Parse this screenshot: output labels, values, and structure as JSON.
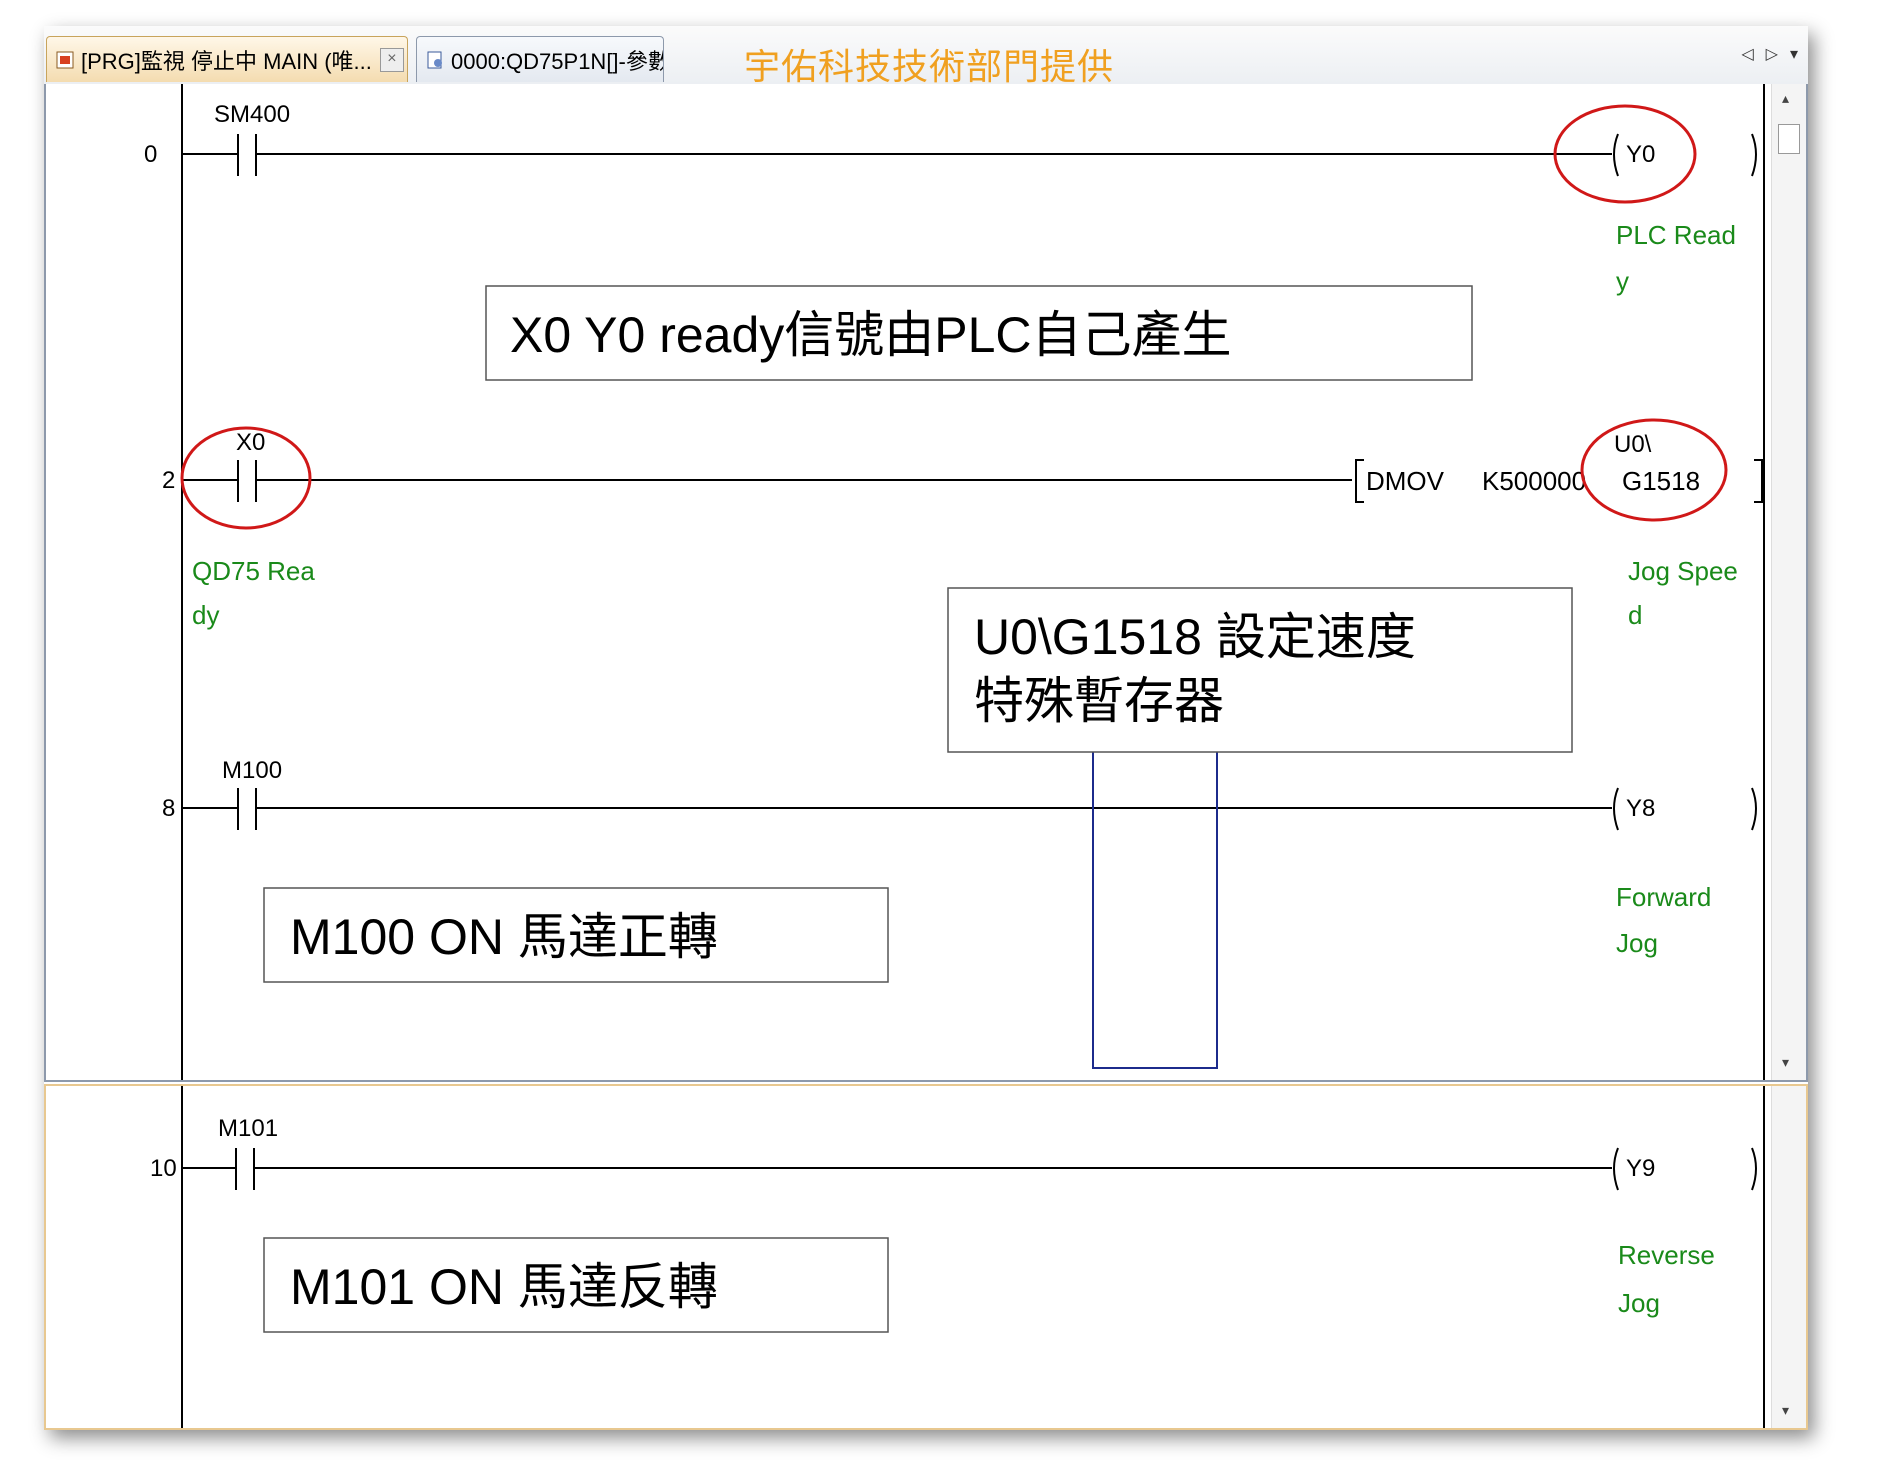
{
  "tabs": [
    {
      "label": "[PRG]監視 停止中 MAIN (唯...",
      "close": "×",
      "icon": "program-icon"
    },
    {
      "label": "0000:QD75P1N[]-參數",
      "icon": "parameter-icon"
    }
  ],
  "banner": "宇佑科技技術部門提供",
  "nav": {
    "left": "◁",
    "right": "▷",
    "dropdown": "▾"
  },
  "scroll": {
    "up": "▴",
    "down": "▾"
  },
  "rungs": [
    {
      "step": "0",
      "contact": "SM400",
      "coil": "Y0",
      "comment": [
        "PLC Read",
        "y"
      ]
    },
    {
      "step": "2",
      "contact": "X0",
      "contact_comment": [
        "QD75 Rea",
        "dy"
      ],
      "instr": "DMOV",
      "src": "K500000",
      "dst_top": "U0\\",
      "dst": "G1518",
      "comment": [
        "Jog Spee",
        "d"
      ]
    },
    {
      "step": "8",
      "contact": "M100",
      "coil": "Y8",
      "comment": [
        "Forward",
        "Jog"
      ]
    },
    {
      "step": "10",
      "contact": "M101",
      "coil": "Y9",
      "comment": [
        "Reverse",
        "Jog"
      ]
    }
  ],
  "notes": {
    "n1": "X0 Y0 ready信號由PLC自己產生",
    "n2a": "U0\\G1518  設定速度",
    "n2b": "特殊暫存器",
    "n3": "M100 ON 馬達正轉",
    "n4": "M101 ON 馬達反轉"
  },
  "colors": {
    "comment": "#1a8a1a",
    "highlight": "#d01818",
    "cursor": "#1c2b8c",
    "banner": "#f0a020"
  }
}
